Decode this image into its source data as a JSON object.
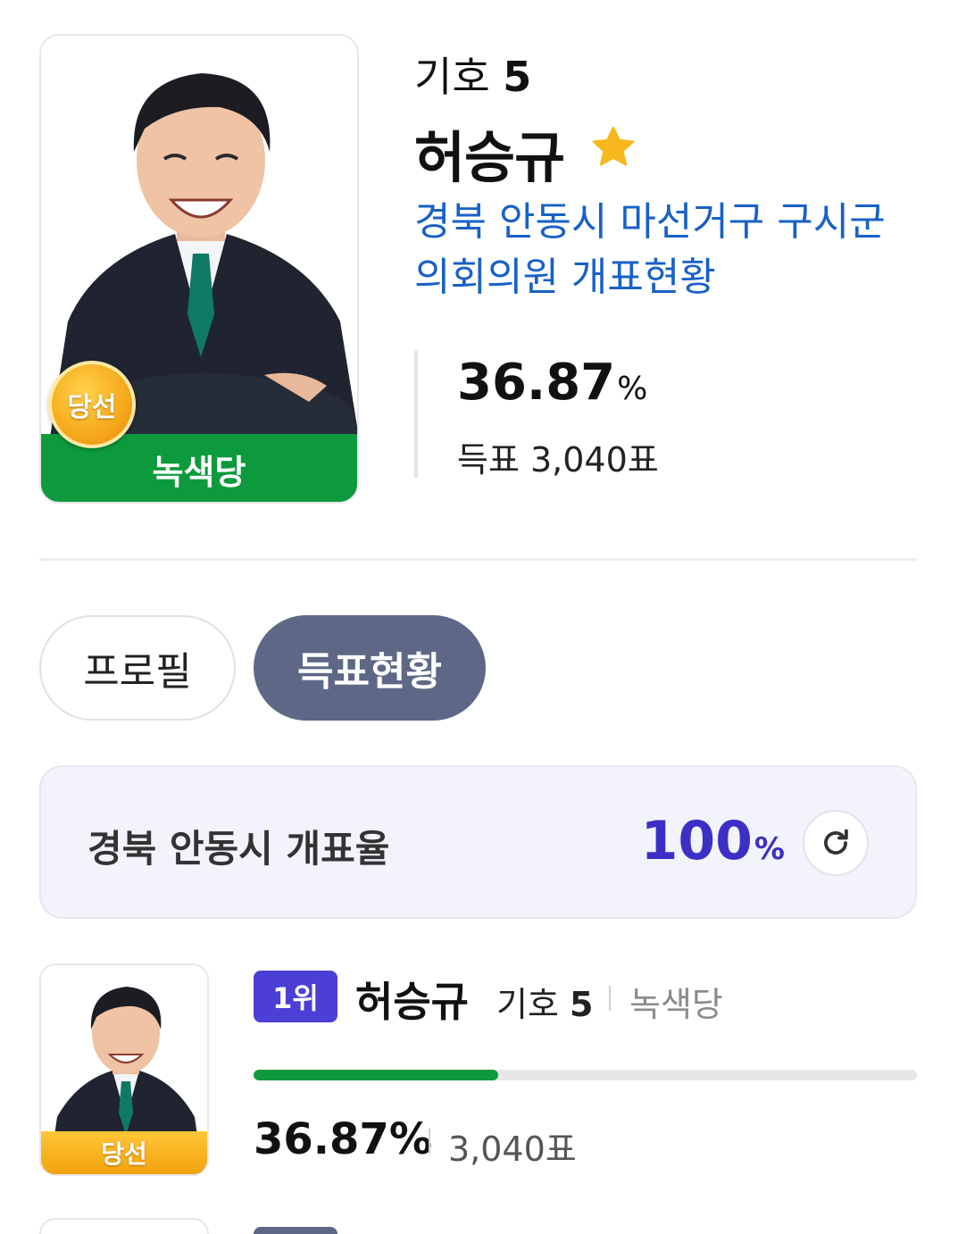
{
  "candidate": {
    "ballot_prefix": "기호",
    "ballot_number": "5",
    "name": "허승규",
    "party": "녹색당",
    "won_badge": "당선",
    "district_link": "경북 안동시 마선거구 구시군의회의원 개표현황",
    "vote_percent": "36.87",
    "percent_unit": "%",
    "votes_text": "득표 3,040표",
    "favorite_icon": "star-icon"
  },
  "tabs": [
    {
      "label": "프로필",
      "active": false
    },
    {
      "label": "득표현황",
      "active": true
    }
  ],
  "count_rate": {
    "label": "경북 안동시 개표율",
    "value": "100",
    "unit": "%",
    "refresh_icon": "refresh-icon"
  },
  "results": [
    {
      "rank": "1위",
      "name": "허승규",
      "ballot_prefix": "기호",
      "ballot_number": "5",
      "party": "녹색당",
      "won_badge": "당선",
      "percent_text": "36.87%",
      "share": 0.3687,
      "votes": "3,040표"
    }
  ],
  "colors": {
    "party_green": "#0d9a3d",
    "link_blue": "#1861c7",
    "rank_purple": "#4b3fd6",
    "rate_purple": "#3b2fc6",
    "tab_active": "#5e6886",
    "badge_gold": "#f6a91b"
  }
}
